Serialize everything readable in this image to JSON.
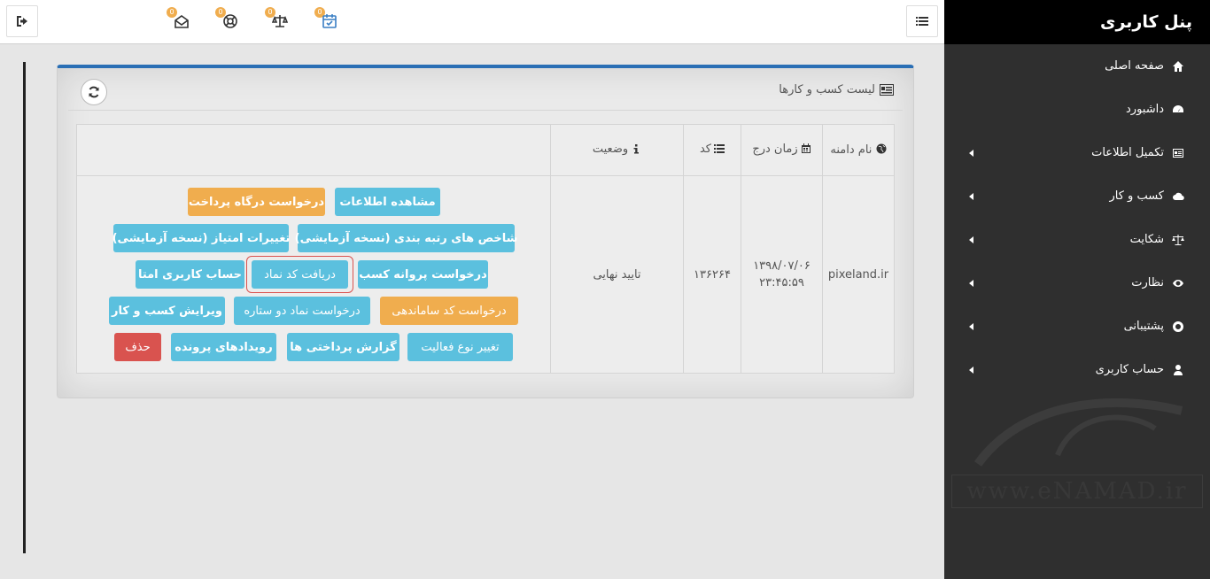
{
  "sidebar": {
    "brand": "پنل کاربری",
    "items": [
      {
        "label": "صفحه اصلی",
        "icon": "home-icon",
        "has_submenu": false
      },
      {
        "label": "داشبورد",
        "icon": "dashboard-icon",
        "has_submenu": false
      },
      {
        "label": "تکمیل اطلاعات",
        "icon": "id-card-icon",
        "has_submenu": true
      },
      {
        "label": "کسب و کار",
        "icon": "cloud-icon",
        "has_submenu": true
      },
      {
        "label": "شکایت",
        "icon": "balance-scale-icon",
        "has_submenu": true
      },
      {
        "label": "نظارت",
        "icon": "eye-icon",
        "has_submenu": true
      },
      {
        "label": "پشتیبانی",
        "icon": "life-ring-icon",
        "has_submenu": true
      },
      {
        "label": "حساب کاربری",
        "icon": "user-icon",
        "has_submenu": true
      }
    ],
    "watermark": "www.eNAMAD.ir"
  },
  "topbar": {
    "notifications": [
      {
        "icon": "calendar-check-icon",
        "count": "0"
      },
      {
        "icon": "balance-scale-icon",
        "count": "0"
      },
      {
        "icon": "life-ring-icon",
        "count": "0"
      },
      {
        "icon": "envelope-open-icon",
        "count": "0"
      }
    ]
  },
  "panel": {
    "title": "لیست کسب و کارها",
    "columns": {
      "domain": "نام دامنه",
      "date": "زمان درج",
      "code": "کد",
      "status": "وضعیت"
    },
    "rows": [
      {
        "domain": "pixeland.ir",
        "date": "۱۳۹۸/۰۷/۰۶",
        "time": "۲۳:۴۵:۵۹",
        "code": "۱۳۶۲۶۴",
        "status": "تایید نهایی"
      }
    ],
    "actions": {
      "view_info": "مشاهده اطلاعات",
      "payment_gateway": "درخواست درگاه پرداخت",
      "ranking_indicators": "شاخص های رتبه بندی (نسخه آزمایشی)",
      "score_changes": "تغییرات امتیاز (نسخه آزمایشی)",
      "license_request": "درخواست پروانه کسب",
      "get_namad_code": "دریافت کد نماد",
      "emta_account": "حساب کاربری امتا",
      "samandehi_code": "درخواست کد ساماندهی",
      "two_star_request": "درخواست نماد دو ستاره",
      "edit_business": "ویرایش کسب و کار",
      "change_activity": "تغییر نوع فعالیت",
      "payment_reports": "گزارش پرداختی ها",
      "case_events": "رویدادهای پرونده",
      "delete": "حذف"
    }
  }
}
